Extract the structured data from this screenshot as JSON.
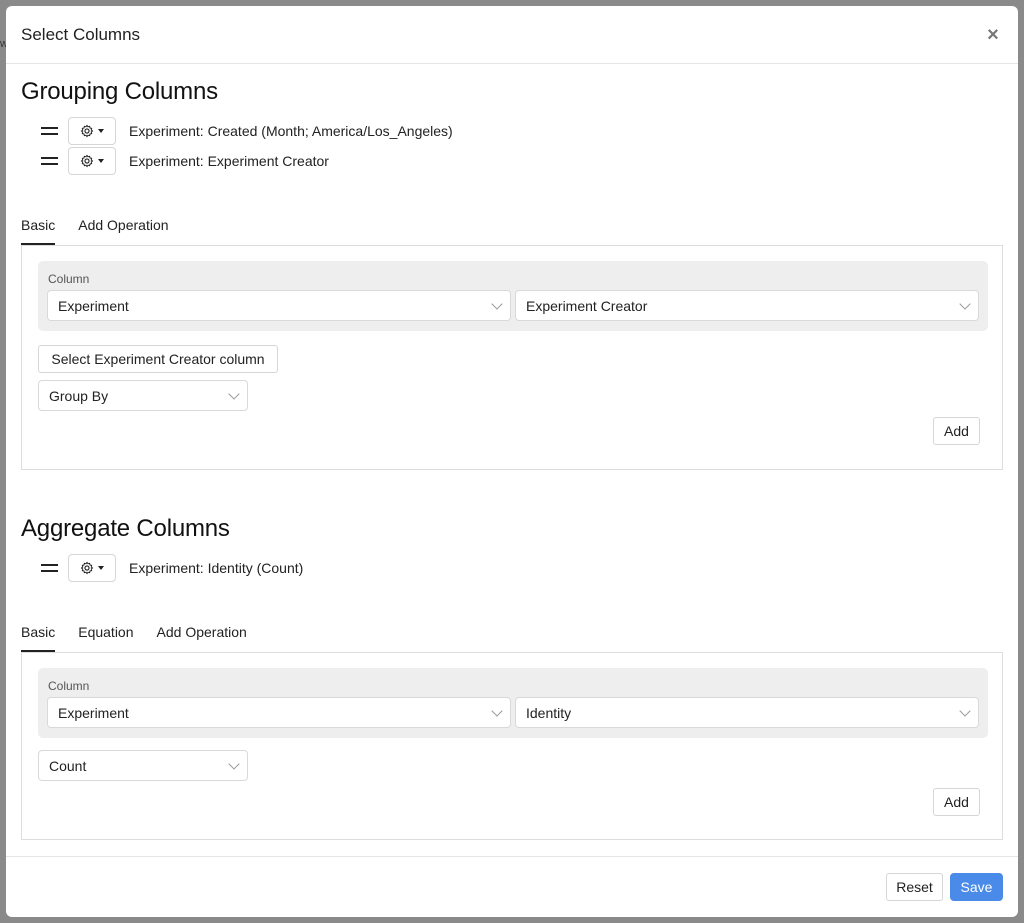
{
  "modal": {
    "title": "Select Columns",
    "close_label": "×"
  },
  "grouping": {
    "title": "Grouping Columns",
    "columns": [
      {
        "label": "Experiment: Created (Month; America/Los_Angeles)"
      },
      {
        "label": "Experiment: Experiment Creator"
      }
    ],
    "tabs": [
      "Basic",
      "Add Operation"
    ],
    "active_tab": "Basic",
    "column_label": "Column",
    "table_select": "Experiment",
    "field_select": "Experiment Creator",
    "select_column_button": "Select Experiment Creator column",
    "operation_select": "Group By",
    "add_button": "Add"
  },
  "aggregate": {
    "title": "Aggregate Columns",
    "columns": [
      {
        "label": "Experiment: Identity (Count)"
      }
    ],
    "tabs": [
      "Basic",
      "Equation",
      "Add Operation"
    ],
    "active_tab": "Basic",
    "column_label": "Column",
    "table_select": "Experiment",
    "field_select": "Identity",
    "operation_select": "Count",
    "add_button": "Add"
  },
  "footer": {
    "reset_button": "Reset",
    "save_button": "Save"
  },
  "icons": {
    "drag": "drag-handle-icon",
    "gear": "gear-icon",
    "caret": "caret-down-icon",
    "chevron": "chevron-down-icon"
  },
  "colors": {
    "primary": "#4a8ae8",
    "overlay": "#8a8a8a",
    "column_box": "#eeeeef"
  }
}
